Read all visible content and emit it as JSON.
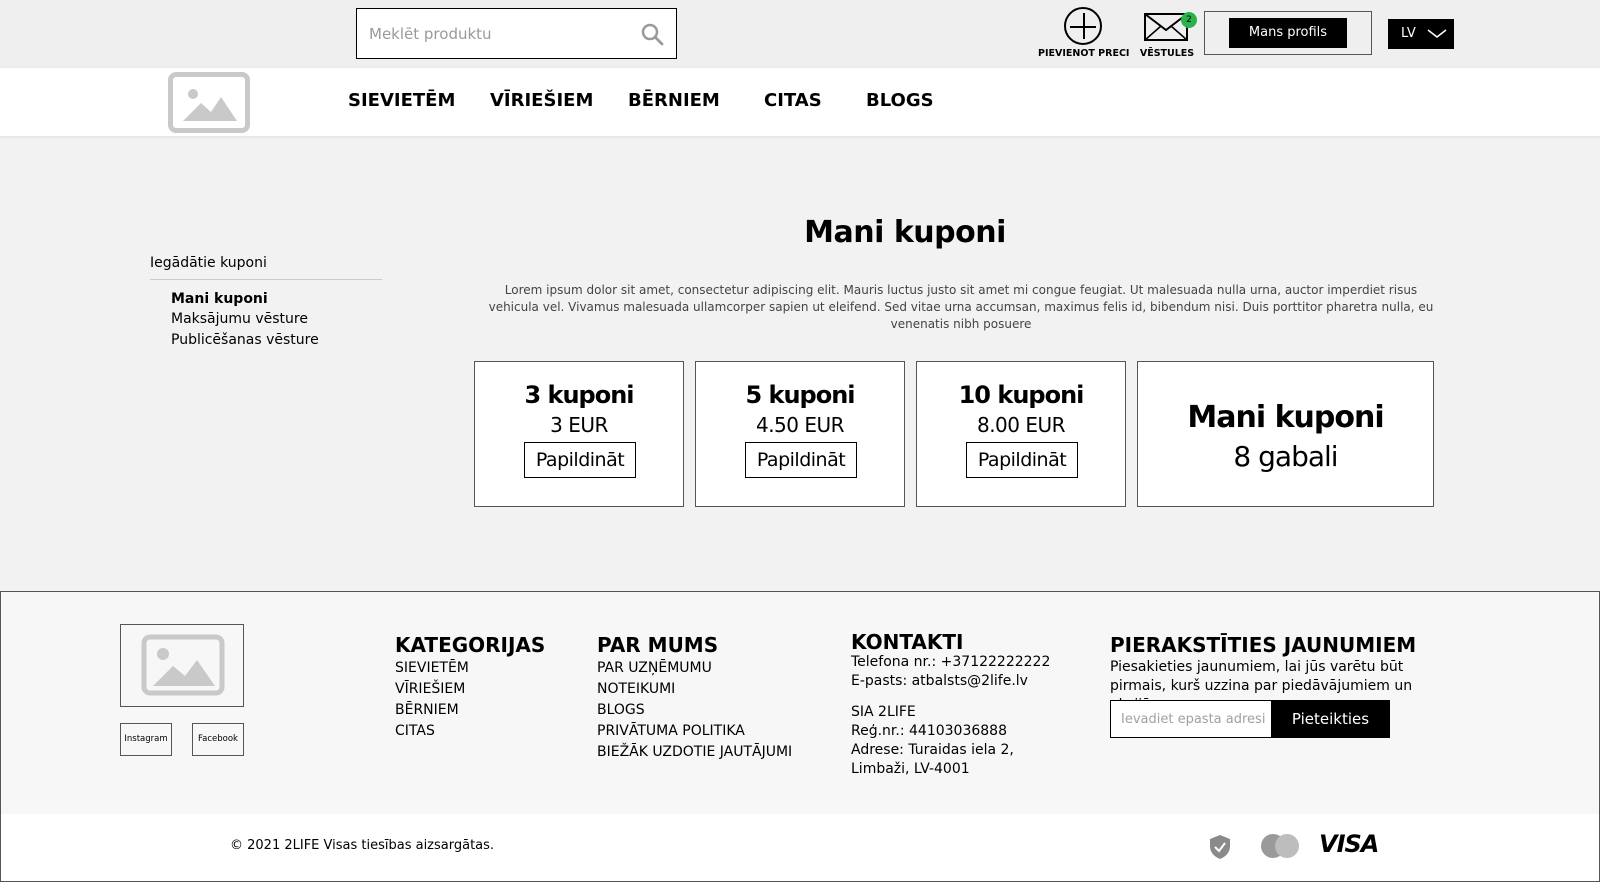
{
  "header": {
    "search_placeholder": "Meklēt produktu",
    "add_product_label": "PIEVIENOT PRECI",
    "messages_label": "VĒSTULES",
    "messages_count": "2",
    "profile_label": "Mans profils",
    "language": "LV"
  },
  "nav": {
    "items": [
      {
        "label": "SIEVIETĒM"
      },
      {
        "label": "VĪRIEŠIEM"
      },
      {
        "label": "BĒRNIEM"
      },
      {
        "label": "CITAS"
      },
      {
        "label": "BLOGS"
      }
    ]
  },
  "sidebar": {
    "heading": "Iegādātie kuponi",
    "items": [
      {
        "label": "Mani kuponi",
        "active": true
      },
      {
        "label": "Maksājumu vēsture",
        "active": false
      },
      {
        "label": "Publicēšanas vēsture",
        "active": false
      }
    ]
  },
  "main": {
    "title": "Mani kuponi",
    "description": "Lorem ipsum dolor sit amet, consectetur adipiscing elit. Mauris luctus justo sit amet mi congue feugiat. Ut malesuada nulla urna, auctor imperdiet risus vehicula vel. Vivamus malesuada ullamcorper sapien ut eleifend. Sed vitae urna accumsan, maximus felis id, bibendum nisi. Duis porttitor pharetra nulla, eu venenatis nibh posuere",
    "packages": [
      {
        "name": "3 kuponi",
        "price": "3 EUR",
        "button": "Papildināt"
      },
      {
        "name": "5 kuponi",
        "price": "4.50 EUR",
        "button": "Papildināt"
      },
      {
        "name": "10 kuponi",
        "price": "8.00 EUR",
        "button": "Papildināt"
      }
    ],
    "total": {
      "title": "Mani kuponi",
      "count": "8 gabali"
    }
  },
  "footer": {
    "social": [
      "Instagram",
      "Facebook"
    ],
    "categories": {
      "heading": "KATEGORIJAS",
      "links": [
        "SIEVIETĒM",
        "VĪRIEŠIEM",
        "BĒRNIEM",
        "CITAS"
      ]
    },
    "about": {
      "heading": "PAR MUMS",
      "links": [
        "PAR UZŅĒMUMU",
        "NOTEIKUMI",
        "BLOGS",
        "PRIVĀTUMA POLITIKA",
        "BIEŽĀK UZDOTIE JAUTĀJUMI"
      ]
    },
    "contacts": {
      "heading": "KONTAKTI",
      "phone": "Telefona nr.: +37122222222",
      "email": "E-pasts:  atbalsts@2life.lv",
      "company": "SIA 2LIFE",
      "reg": "Reģ.nr.: 44103036888",
      "address1": "Adrese: Turaidas iela 2,",
      "address2": "Limbaži, LV-4001"
    },
    "newsletter": {
      "heading": "PIERAKSTĪTIES JAUNUMIEM",
      "text": "Piesakieties jaunumiem, lai jūs varētu būt pirmais, kurš uzzina par piedāvājumiem un akcijām.",
      "placeholder": "Ievadiet epasta adresi",
      "button": "Pieteikties"
    },
    "copyright": "© 2021 2LIFE Visas tiesības aizsargātas.",
    "payment_icons": [
      "shield-icon",
      "mastercard-icon",
      "visa-logo"
    ],
    "visa_text": "VISA"
  },
  "colors": {
    "page_bg": "#f2f2f2",
    "badge": "#2bb24c",
    "placeholder_gray": "#c9c9c9"
  }
}
